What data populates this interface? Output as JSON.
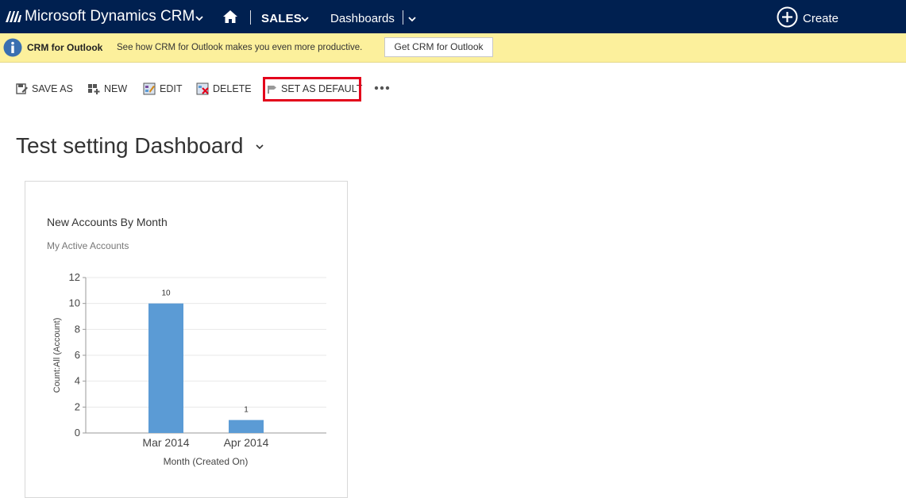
{
  "topnav": {
    "app_title": "Microsoft Dynamics CRM",
    "area": "SALES",
    "page": "Dashboards",
    "create_label": "Create",
    "bg_color": "#002050"
  },
  "notification": {
    "title": "CRM for Outlook",
    "message": "See how CRM for Outlook makes you even more productive.",
    "button_label": "Get CRM for Outlook",
    "bg_color": "#fcf09c"
  },
  "commandbar": {
    "save_as": "SAVE AS",
    "new": "NEW",
    "edit": "EDIT",
    "delete": "DELETE",
    "set_as_default": "SET AS DEFAULT",
    "highlight_color": "#e3001b"
  },
  "dashboard": {
    "title": "Test setting Dashboard"
  },
  "chart": {
    "title": "New Accounts By Month",
    "view": "My Active Accounts"
  },
  "chart_data": {
    "type": "bar",
    "categories": [
      "Mar 2014",
      "Apr 2014"
    ],
    "values": [
      10,
      1
    ],
    "data_labels": [
      "10",
      "1"
    ],
    "title": "New Accounts By Month",
    "subtitle": "My Active Accounts",
    "xlabel": "Month (Created On)",
    "ylabel": "Count:All (Account)",
    "ylim": [
      0,
      12
    ],
    "yticks": [
      0,
      2,
      4,
      6,
      8,
      10,
      12
    ],
    "grid": true,
    "bar_color": "#5b9bd5"
  }
}
